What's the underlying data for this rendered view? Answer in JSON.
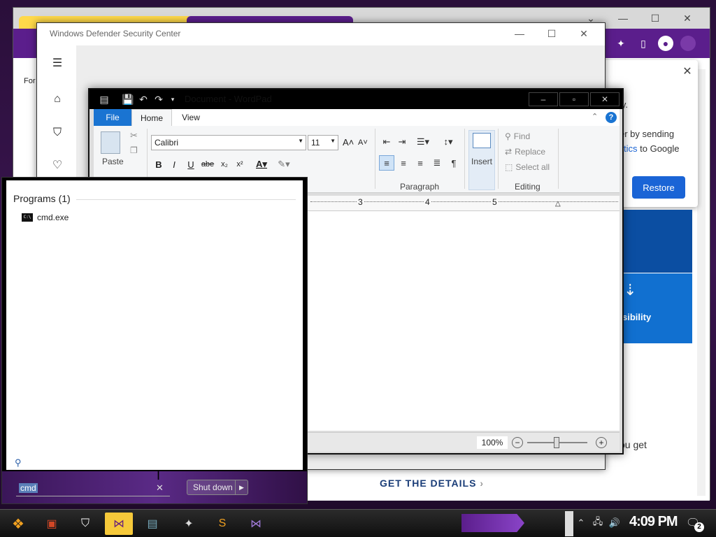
{
  "chrome": {
    "sync_text": [
      "ly.",
      "er by sending",
      "tics",
      "to Google"
    ],
    "restore_label": "Restore",
    "accessibility_text": "sibility",
    "you_get": "ou get",
    "get_details": "GET THE DETAILS"
  },
  "defender": {
    "title": "Windows Defender Security Center",
    "behind_label": "For"
  },
  "wordpad": {
    "title": "Document - WordPad",
    "tabs": {
      "file": "File",
      "home": "Home",
      "view": "View"
    },
    "help": "?",
    "clipboard": {
      "paste": "Paste"
    },
    "font": {
      "name": "Calibri",
      "size": "11"
    },
    "format_buttons": [
      "B",
      "I",
      "U",
      "abe",
      "x₂",
      "x²"
    ],
    "groups": {
      "paragraph": "Paragraph",
      "editing": "Editing"
    },
    "insert_label": "Insert",
    "editing": {
      "find": "Find",
      "replace": "Replace",
      "select_all": "Select all"
    },
    "ruler": {
      "marks": [
        "3",
        "4",
        "5"
      ]
    },
    "zoom": {
      "value": "100%"
    }
  },
  "startmenu": {
    "heading": "Programs (1)",
    "program": "cmd.exe",
    "search_value": "cmd",
    "shutdown": "Shut down"
  },
  "taskbar": {
    "time": "4:09 PM",
    "notifications": "2"
  }
}
